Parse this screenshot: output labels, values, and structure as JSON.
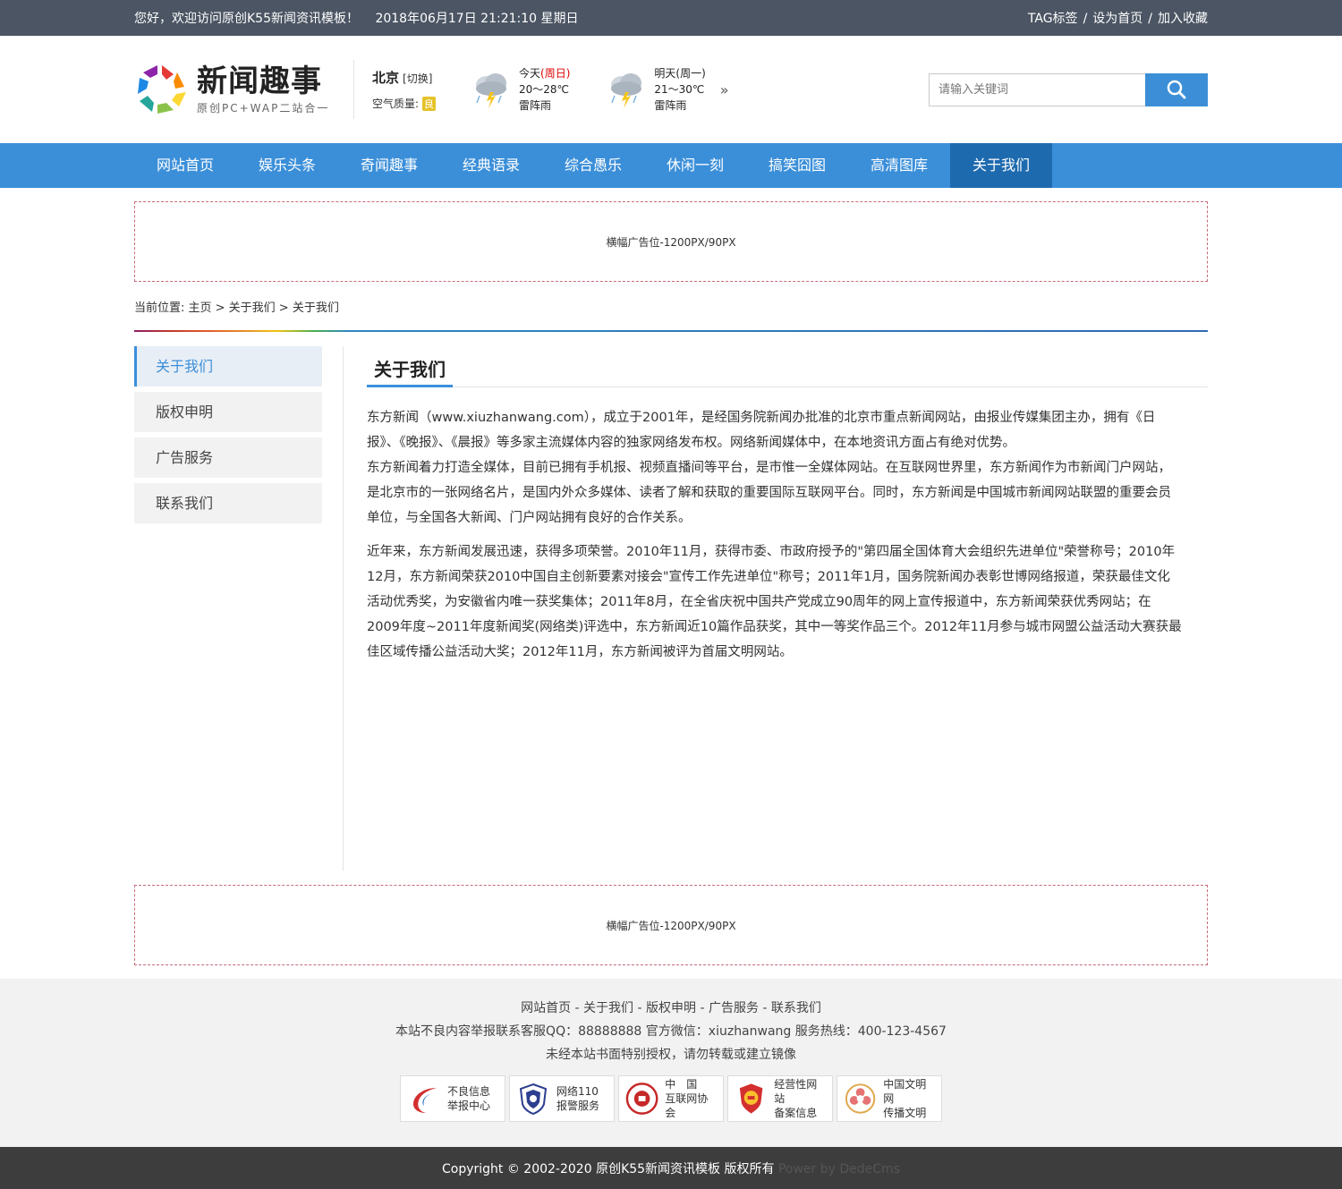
{
  "topbar": {
    "welcome": "您好，欢迎访问原创K55新闻资讯模板！",
    "datetime": "2018年06月17日 21:21:10 星期日",
    "links": [
      "TAG标签",
      "设为首页",
      "加入收藏"
    ],
    "separator": "/"
  },
  "logo": {
    "title": "新闻趣事",
    "subtitle": "原创PC+WAP二站合一"
  },
  "weather": {
    "city": "北京",
    "switch": "[切换]",
    "aq_label": "空气质量:",
    "aq_value": "良",
    "today": {
      "label": "今天",
      "weekday": "(周日)",
      "temp": "20～28℃",
      "desc": "雷阵雨"
    },
    "tomorrow": {
      "label": "明天",
      "weekday": "(周一)",
      "temp": "21～30℃",
      "desc": "雷阵雨"
    },
    "more": "»"
  },
  "search": {
    "placeholder": "请输入关键词"
  },
  "nav": [
    "网站首页",
    "娱乐头条",
    "奇闻趣事",
    "经典语录",
    "综合愚乐",
    "休闲一刻",
    "搞笑囧图",
    "高清图库",
    "关于我们"
  ],
  "ad_text": "横幅广告位-1200PX/90PX",
  "breadcrumb": "当前位置: 主页 > 关于我们 > 关于我们",
  "sidebar": [
    "关于我们",
    "版权申明",
    "广告服务",
    "联系我们"
  ],
  "page_title": "关于我们",
  "article": {
    "p1": " 东方新闻（www.xiuzhanwang.com），成立于2001年，是经国务院新闻办批准的北京市重点新闻网站，由报业传媒集团主办，拥有《日报》、《晚报》、《晨报》等多家主流媒体内容的独家网络发布权。网络新闻媒体中，在本地资讯方面占有绝对优势。",
    "p1b": "东方新闻着力打造全媒体，目前已拥有手机报、视频直播间等平台，是市惟一全媒体网站。在互联网世界里，东方新闻作为市新闻门户网站，是北京市的一张网络名片，是国内外众多媒体、读者了解和获取的重要国际互联网平台。同时，东方新闻是中国城市新闻网站联盟的重要会员单位，与全国各大新闻、门户网站拥有良好的合作关系。",
    "p2": "近年来，东方新闻发展迅速，获得多项荣誉。2010年11月，获得市委、市政府授予的\"第四届全国体育大会组织先进单位\"荣誉称号；2010年12月，东方新闻荣获2010中国自主创新要素对接会\"宣传工作先进单位\"称号；2011年1月，国务院新闻办表彰世博网络报道，荣获最佳文化活动优秀奖，为安徽省内唯一获奖集体；2011年8月，在全省庆祝中国共产党成立90周年的网上宣传报道中，东方新闻荣获优秀网站；在2009年度~2011年度新闻奖(网络类)评选中，东方新闻近10篇作品获奖，其中一等奖作品三个。2012年11月参与城市网盟公益活动大赛获最佳区域传播公益活动大奖；2012年11月，东方新闻被评为首届文明网站。"
  },
  "footer": {
    "links": "网站首页 - 关于我们 - 版权申明 - 广告服务 - 联系我们",
    "contact": "本站不良内容举报联系客服QQ：88888888 官方微信：xiuzhanwang 服务热线：400-123-4567",
    "notice": "未经本站书面特别授权，请勿转载或建立镜像",
    "badges": [
      {
        "l1": "不良信息",
        "l2": "举报中心",
        "icon": "report-center-icon"
      },
      {
        "l1": "网络110",
        "l2": "报警服务",
        "icon": "police-110-icon"
      },
      {
        "l1": "中　国",
        "l2": "互联网协会",
        "icon": "internet-society-icon"
      },
      {
        "l1": "经营性网站",
        "l2": "备案信息",
        "icon": "registration-icon"
      },
      {
        "l1": "中国文明网",
        "l2": "传播文明",
        "icon": "civilization-icon"
      }
    ],
    "copyright": "Copyright © 2002-2020 原创K55新闻资讯模板 版权所有",
    "powered": "Power by DedeCms"
  },
  "colors": {
    "topbar": "#4b5563",
    "nav": "#3b8fd9",
    "nav_active": "#1e6aaf",
    "accent": "#3b8fd9",
    "footer_bg": "#f2f2f2",
    "copyright_bg": "#3d3d3d"
  }
}
